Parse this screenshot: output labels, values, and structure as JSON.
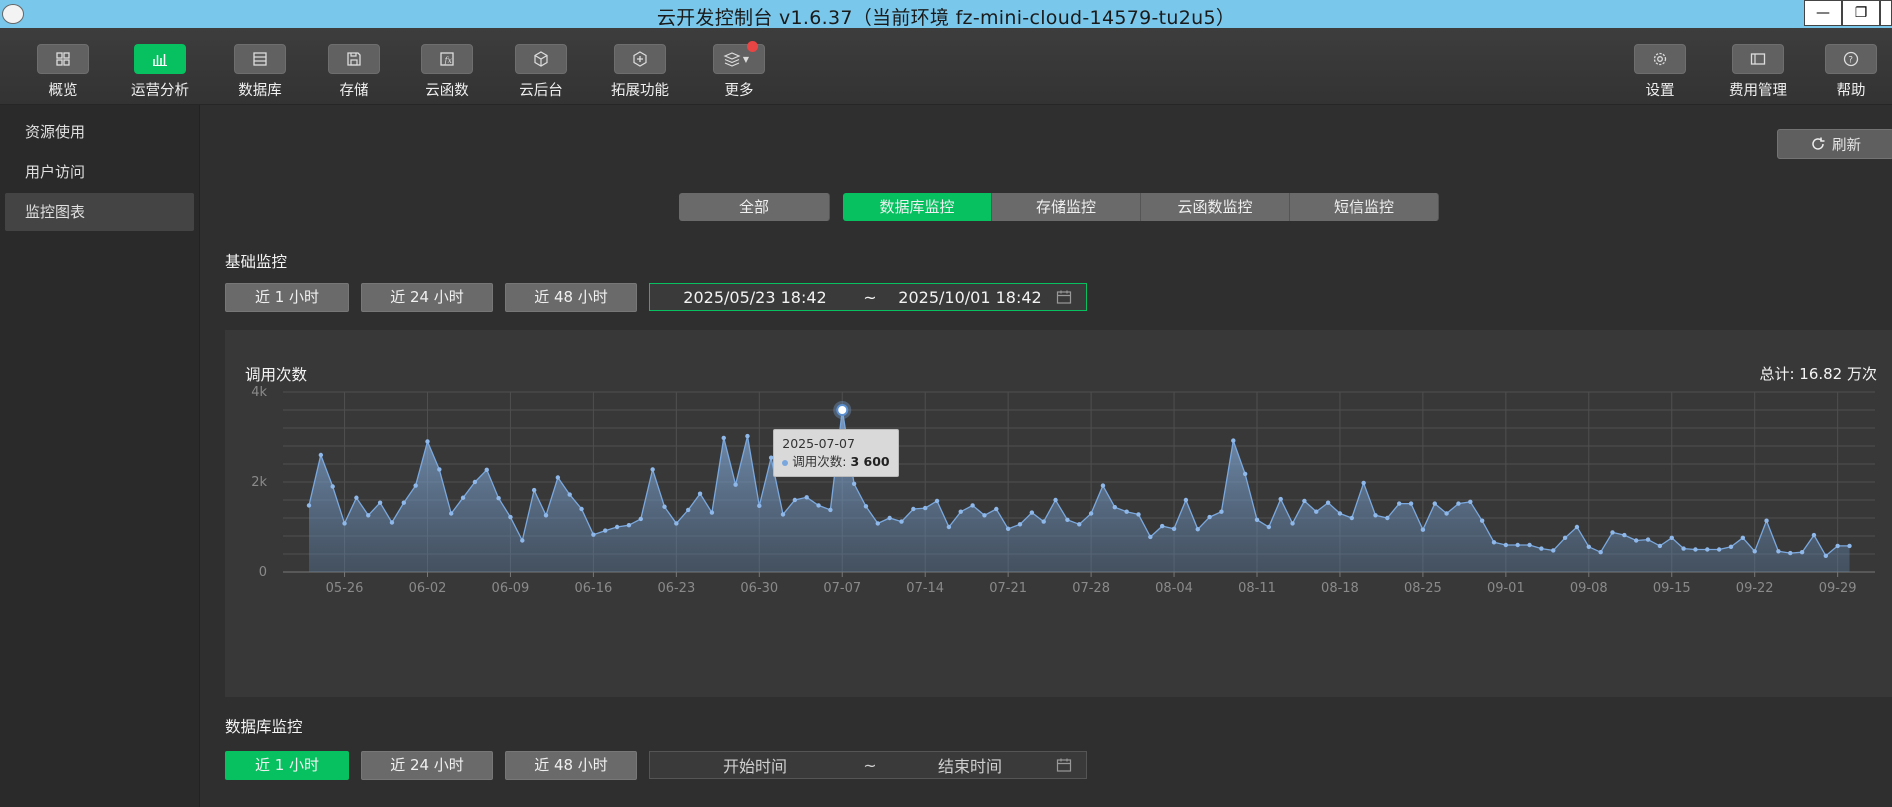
{
  "window": {
    "title": "云开发控制台 v1.6.37（当前环境 fz-mini-cloud-14579-tu2u5）"
  },
  "toolbar": {
    "left": [
      {
        "label": "概览",
        "icon": "grid-icon",
        "active": false
      },
      {
        "label": "运营分析",
        "icon": "bar-chart-icon",
        "active": true
      },
      {
        "label": "数据库",
        "icon": "database-icon",
        "active": false
      },
      {
        "label": "存储",
        "icon": "save-icon",
        "active": false
      },
      {
        "label": "云函数",
        "icon": "function-icon",
        "active": false
      },
      {
        "label": "云后台",
        "icon": "cube-icon",
        "active": false
      },
      {
        "label": "拓展功能",
        "icon": "extension-icon",
        "active": false
      },
      {
        "label": "更多",
        "icon": "layers-icon",
        "active": false
      }
    ],
    "right": [
      {
        "label": "设置",
        "icon": "gear-icon"
      },
      {
        "label": "费用管理",
        "icon": "card-icon"
      },
      {
        "label": "帮助",
        "icon": "help-icon"
      }
    ]
  },
  "sidebar": {
    "items": [
      {
        "label": "资源使用",
        "active": false
      },
      {
        "label": "用户访问",
        "active": false
      },
      {
        "label": "监控图表",
        "active": true
      }
    ]
  },
  "main": {
    "refresh_label": "刷新",
    "tabs": [
      "全部",
      "数据库监控",
      "存储监控",
      "云函数监控",
      "短信监控"
    ],
    "active_tab": "数据库监控",
    "basic": {
      "title": "基础监控",
      "ranges": [
        "近 1 小时",
        "近 24 小时",
        "近 48 小时"
      ],
      "start": "2025/05/23 18:42",
      "sep": "~",
      "end": "2025/10/01 18:42"
    },
    "db": {
      "title": "数据库监控",
      "ranges": [
        "近 1 小时",
        "近 24 小时",
        "近 48 小时"
      ],
      "start_placeholder": "开始时间",
      "sep": "~",
      "end_placeholder": "结束时间"
    }
  },
  "chart_data": {
    "type": "area",
    "title": "调用次数",
    "total_label": "总计: 16.82 万次",
    "x_start": "2025-05-23",
    "x_tick_labels": [
      "05-26",
      "06-02",
      "06-09",
      "06-16",
      "06-23",
      "06-30",
      "07-07",
      "07-14",
      "07-21",
      "07-28",
      "08-04",
      "08-11",
      "08-18",
      "08-25",
      "09-01",
      "09-08",
      "09-15",
      "09-22",
      "09-29"
    ],
    "y_tick_labels": [
      "0",
      "2k",
      "4k"
    ],
    "ylim": [
      0,
      4000
    ],
    "grid": true,
    "series": [
      {
        "name": "调用次数",
        "color": "#7aa8de",
        "values": [
          1480,
          2600,
          1900,
          1080,
          1650,
          1260,
          1540,
          1100,
          1540,
          1920,
          2900,
          2280,
          1300,
          1650,
          2000,
          2270,
          1640,
          1220,
          700,
          1820,
          1260,
          2100,
          1720,
          1400,
          830,
          920,
          1000,
          1040,
          1180,
          2280,
          1450,
          1080,
          1380,
          1740,
          1320,
          2980,
          1940,
          3020,
          1470,
          2540,
          1280,
          1600,
          1660,
          1480,
          1380,
          3600,
          1960,
          1460,
          1080,
          1200,
          1120,
          1400,
          1420,
          1580,
          1000,
          1340,
          1480,
          1260,
          1400,
          960,
          1060,
          1320,
          1120,
          1600,
          1160,
          1060,
          1300,
          1920,
          1440,
          1340,
          1280,
          780,
          1020,
          960,
          1600,
          950,
          1220,
          1340,
          2920,
          2180,
          1160,
          1000,
          1620,
          1080,
          1580,
          1340,
          1540,
          1300,
          1200,
          1980,
          1260,
          1200,
          1520,
          1520,
          940,
          1520,
          1300,
          1520,
          1560,
          1140,
          660,
          600,
          600,
          600,
          520,
          480,
          760,
          1000,
          560,
          440,
          880,
          820,
          700,
          720,
          580,
          760,
          520,
          500,
          500,
          500,
          560,
          760,
          460,
          1140,
          460,
          420,
          440,
          820,
          360,
          580,
          580
        ]
      }
    ],
    "tooltip": {
      "date": "2025-07-07",
      "series": "调用次数",
      "value": "3 600"
    }
  }
}
